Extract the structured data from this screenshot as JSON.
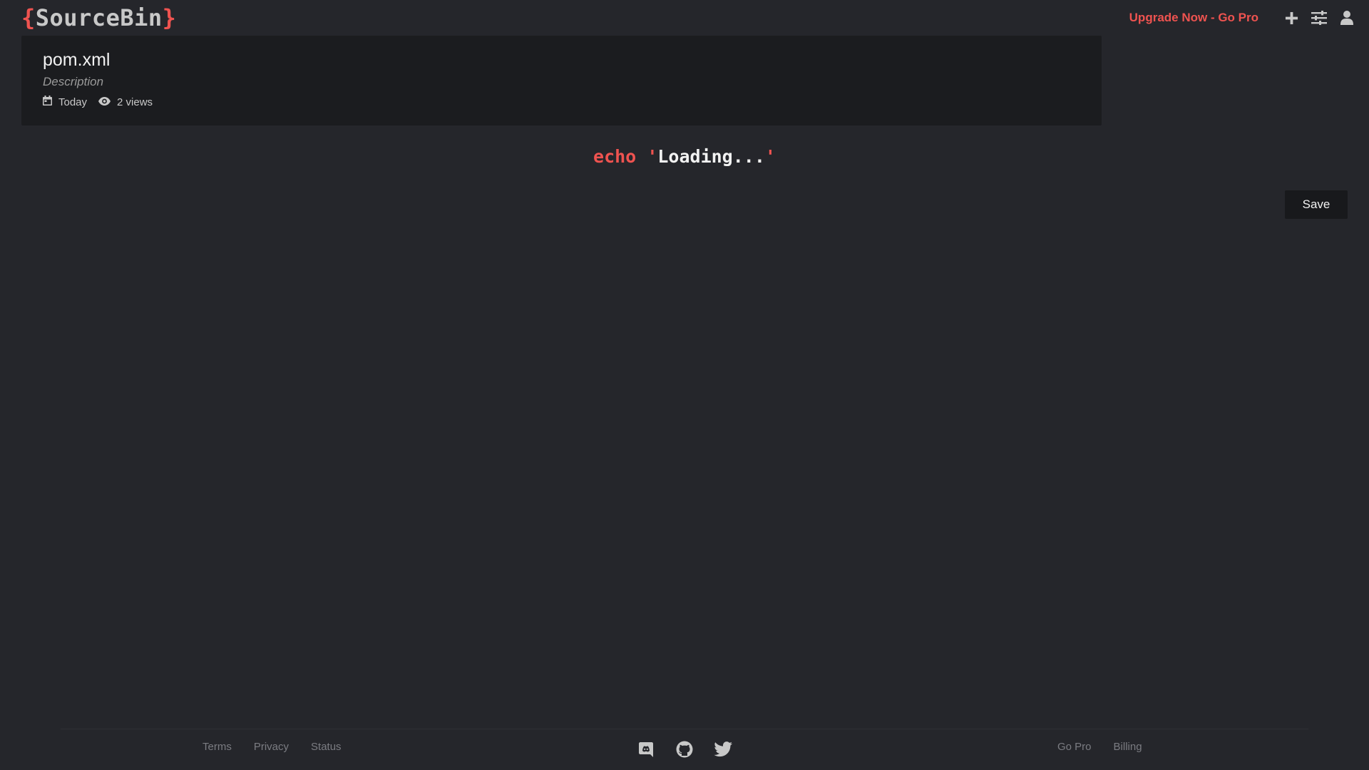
{
  "header": {
    "logo": {
      "open_brace": "{",
      "name": "SourceBin",
      "close_brace": "}"
    },
    "upgrade_link": "Upgrade Now - Go Pro",
    "icons": [
      "plus-icon",
      "sliders-icon",
      "user-icon"
    ]
  },
  "bin": {
    "title": "pom.xml",
    "description": "Description",
    "date": "Today",
    "views": "2 views"
  },
  "loading": {
    "keyword": "echo",
    "quote_open": "'",
    "text": "Loading...",
    "quote_close": "'"
  },
  "actions": {
    "save_label": "Save"
  },
  "footer": {
    "left_links": [
      "Terms",
      "Privacy",
      "Status"
    ],
    "social_icons": [
      "discord-icon",
      "github-icon",
      "twitter-icon"
    ],
    "right_links": [
      "Go Pro",
      "Billing"
    ]
  },
  "colors": {
    "background": "#25262b",
    "card": "#1b1c1f",
    "accent": "#ef5350"
  }
}
